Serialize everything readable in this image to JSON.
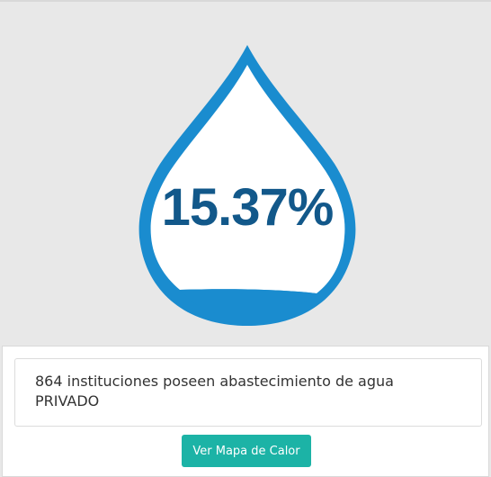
{
  "indicator": {
    "percentage_text": "15.37%",
    "percentage_value": 15.37,
    "description_line1": "864 instituciones poseen abastecimiento de agua",
    "description_line2": "PRIVADO"
  },
  "actions": {
    "heat_map_label": "Ver Mapa de Calor"
  },
  "colors": {
    "drop_fill": "#1a8ccf",
    "drop_inner": "#ffffff",
    "percent_text": "#12588a",
    "button": "#1cb3a6",
    "panel_background": "#e8e8e8"
  }
}
